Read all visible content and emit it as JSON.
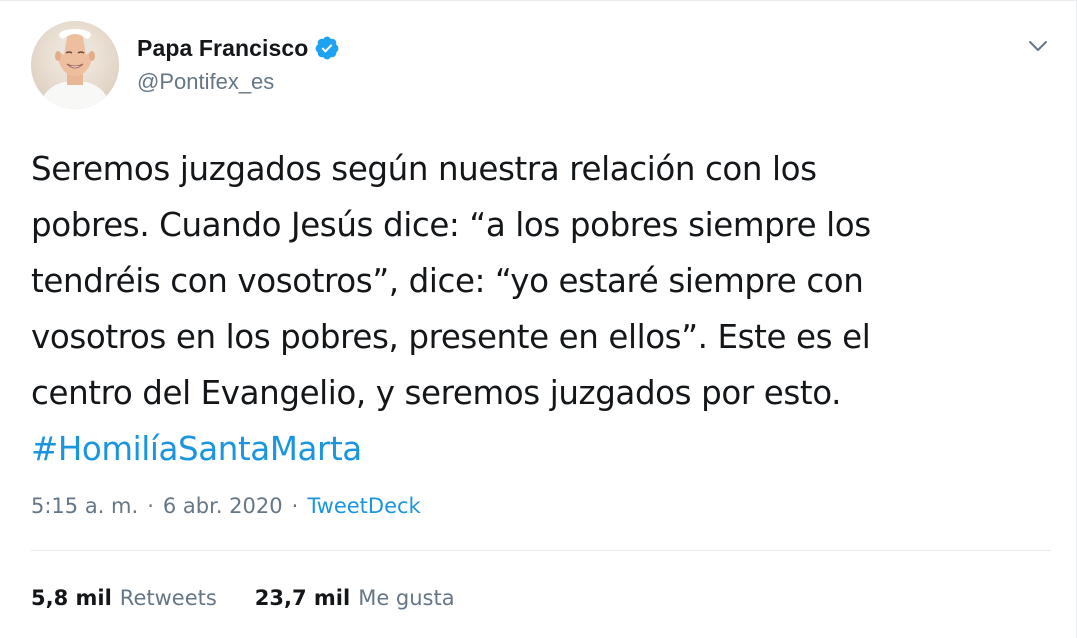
{
  "author": {
    "display_name": "Papa Francisco",
    "handle": "@Pontifex_es",
    "verified_icon": "verified-badge-icon",
    "avatar": "avatar-photo"
  },
  "menu": {
    "icon": "chevron-down-icon"
  },
  "tweet": {
    "lines": [
      "Seremos juzgados según nuestra relación con los",
      "pobres. Cuando Jesús dice: “a los pobres siempre los",
      "tendréis con vosotros”, dice: “yo estaré siempre con",
      "vosotros en los pobres, presente en ellos”. Este es el",
      "centro del Evangelio, y seremos juzgados por esto."
    ],
    "hashtag": "#HomilíaSantaMarta"
  },
  "meta": {
    "time": "5:15 a. m.",
    "separator1": "·",
    "date": "6 abr. 2020",
    "separator2": "·",
    "source": "TweetDeck"
  },
  "stats": {
    "retweets_count": "5,8 mil",
    "retweets_label": "Retweets",
    "likes_count": "23,7 mil",
    "likes_label": "Me gusta"
  },
  "colors": {
    "link": "#1b95e0",
    "secondary_text": "#657786",
    "primary_text": "#14171a",
    "divider": "#e6ecf0",
    "verified": "#1da1f2"
  }
}
